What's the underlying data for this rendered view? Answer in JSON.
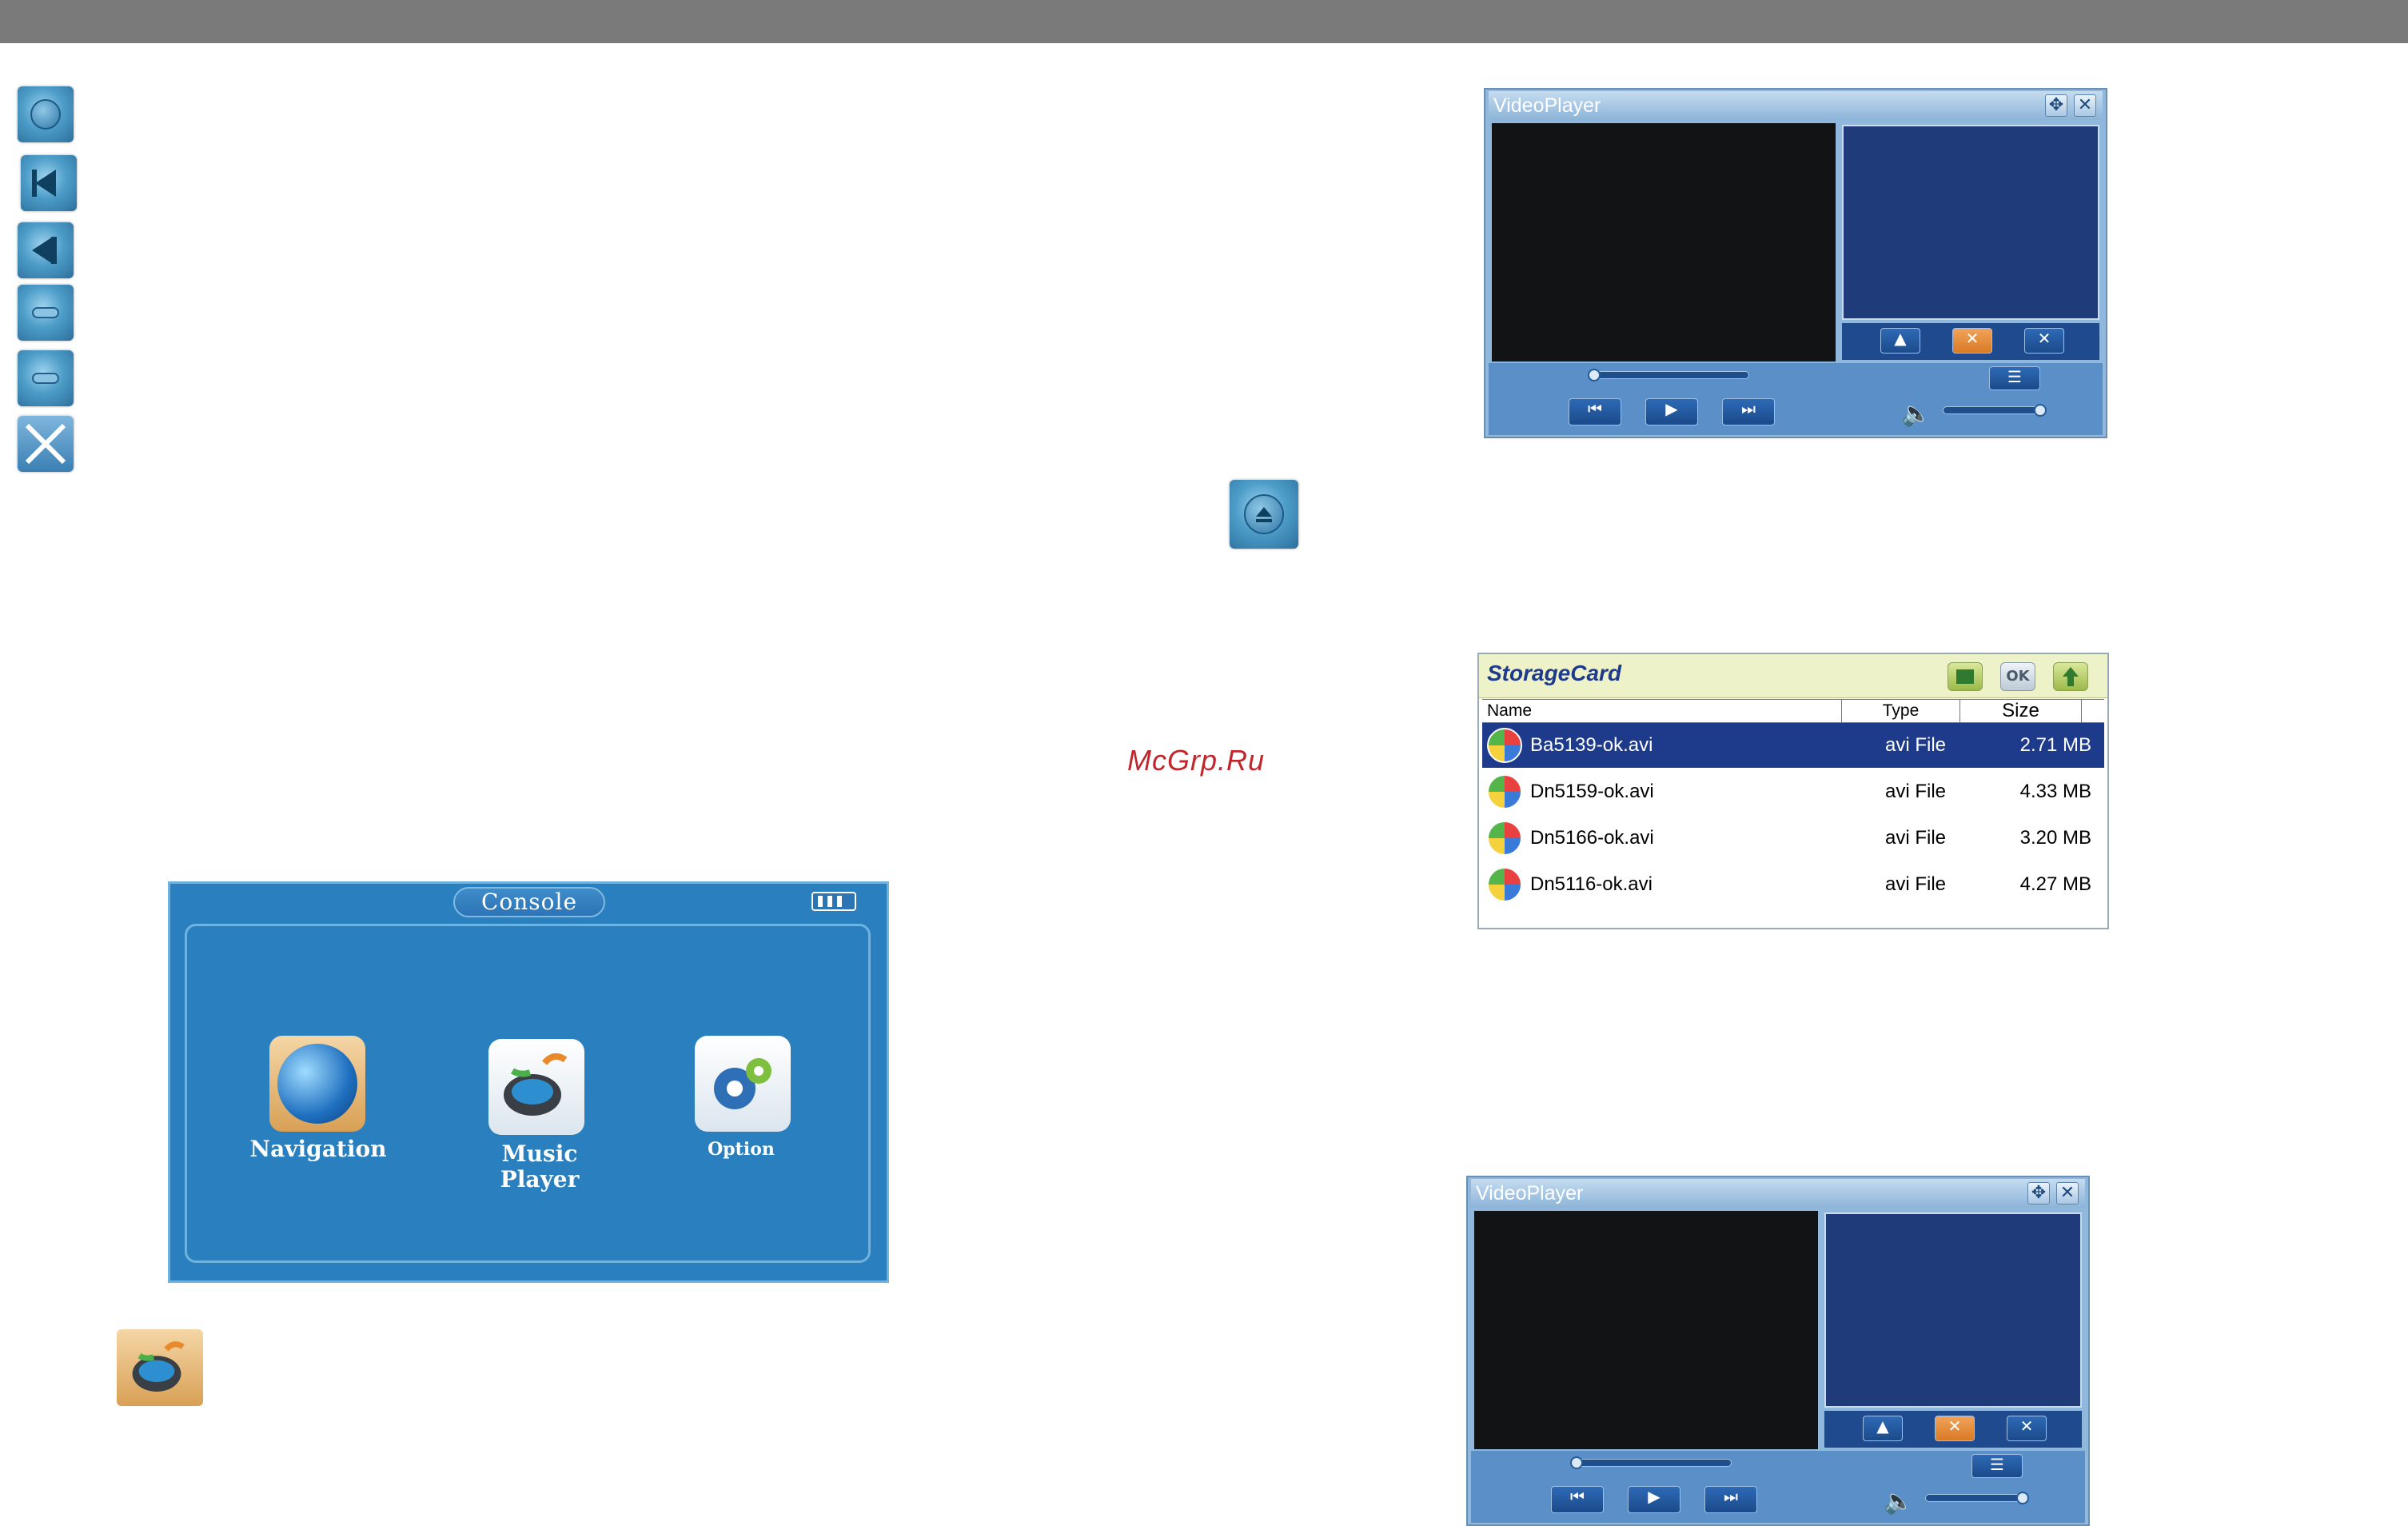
{
  "watermark": "McGrp.Ru",
  "video_player_top": {
    "title": "VideoPlayer"
  },
  "video_player_bottom": {
    "title": "VideoPlayer"
  },
  "file_browser": {
    "path": "StorageCard",
    "columns": {
      "name": "Name",
      "type": "Type",
      "size": "Size"
    },
    "toolbar": {
      "ok_label": "OK"
    },
    "files": [
      {
        "name": "Ba5139-ok.avi",
        "type": "avi File",
        "size": "2.71 MB"
      },
      {
        "name": "Dn5159-ok.avi",
        "type": "avi File",
        "size": "4.33 MB"
      },
      {
        "name": "Dn5166-ok.avi",
        "type": "avi File",
        "size": "3.20 MB"
      },
      {
        "name": "Dn5116-ok.avi",
        "type": "avi File",
        "size": "4.27 MB"
      }
    ]
  },
  "console": {
    "title": "Console",
    "apps": [
      {
        "label": "Navigation"
      },
      {
        "label": "Music\nPlayer"
      },
      {
        "label": "Option"
      }
    ]
  },
  "icons": {
    "left_column": [
      "play-pause-icon",
      "previous-icon",
      "rewind-icon",
      "forward-icon",
      "next-icon",
      "close-icon"
    ],
    "eject": "eject-icon",
    "music_player": "music-player-icon"
  },
  "colors": {
    "top_bar": "#7a7a7a",
    "console_bg": "#2a7fbf",
    "selection": "#1e3a8a",
    "watermark": "#c0262c"
  }
}
